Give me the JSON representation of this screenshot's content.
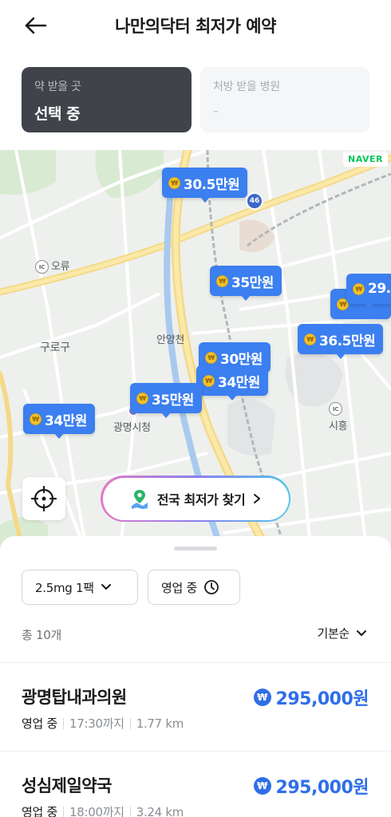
{
  "header": {
    "title": "나만의닥터 최저가 예약"
  },
  "selector": {
    "pharmacy": {
      "label": "약 받을 곳",
      "value": "선택 중"
    },
    "hospital": {
      "label": "처방 받을 병원",
      "value": "-"
    }
  },
  "map": {
    "provider": "NAVER",
    "route_number": "46",
    "places": [
      {
        "name": "오류",
        "badge": "IC"
      },
      {
        "name": "구로구"
      },
      {
        "name": "안양천"
      },
      {
        "name": "광명시청"
      },
      {
        "name": "시흥",
        "badge": "IC"
      }
    ],
    "price_pins": [
      {
        "price": "30.5만원"
      },
      {
        "price": "35만원"
      },
      {
        "price": "29."
      },
      {
        "price": "36.5만원"
      },
      {
        "price": "30만원"
      },
      {
        "price": "34만원"
      },
      {
        "price": "35만원"
      },
      {
        "price": "34만원"
      }
    ],
    "coin_symbol": "₩",
    "nationwide_button": "전국 최저가 찾기"
  },
  "filters": {
    "dose": "2.5mg 1팩",
    "open": "영업 중"
  },
  "list": {
    "count": "총 10개",
    "sort": "기본순",
    "currency_symbol": "₩",
    "items": [
      {
        "name": "광명탑내과의원",
        "status": "영업 중",
        "hours": "17:30까지",
        "distance": "1.77 km",
        "price": "295,000원"
      },
      {
        "name": "성심제일약국",
        "status": "영업 중",
        "hours": "18:00까지",
        "distance": "3.24 km",
        "price": "295,000원"
      }
    ]
  },
  "colors": {
    "accent": "#3b7ff0",
    "price": "#2f6ee8",
    "active_card": "#40434a",
    "naver_green": "#03c75a"
  }
}
